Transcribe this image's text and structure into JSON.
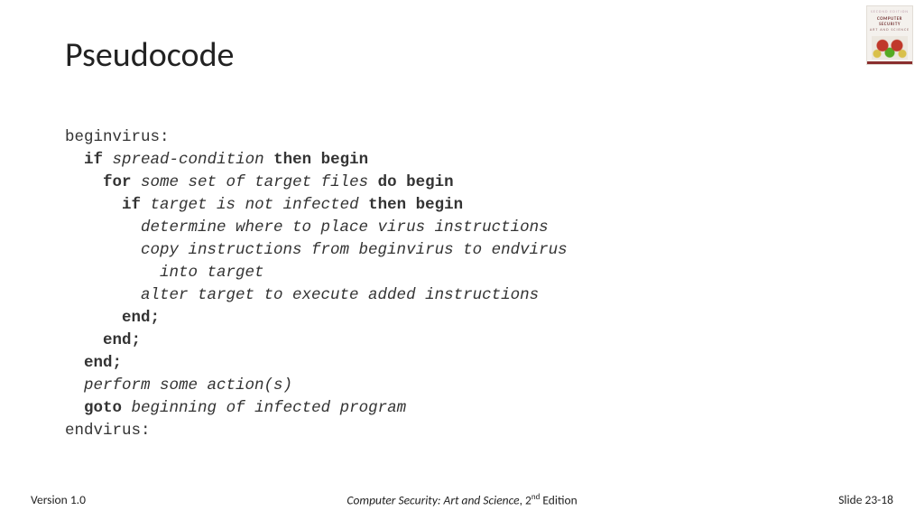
{
  "title": "Pseudocode",
  "code": {
    "l1": "beginvirus:",
    "kw_if1": "if",
    "it_spread": "spread-condition",
    "kw_thenbegin1": "then begin",
    "kw_for": "for",
    "it_someset": "some set of target files",
    "kw_dobegin": "do begin",
    "kw_if2": "if",
    "it_targetnot": "target is not infected",
    "kw_thenbegin2": "then begin",
    "it_determine": "determine where to place virus instructions",
    "it_copy": "copy instructions from beginvirus to endvirus",
    "it_into": "into target",
    "it_alter": "alter target to execute added instructions",
    "kw_end1": "end;",
    "kw_end2": "end;",
    "kw_end3": "end;",
    "it_perform": "perform some action(s)",
    "kw_goto": "goto",
    "it_beginning": "beginning of infected program",
    "l_end": "endvirus:"
  },
  "footer": {
    "left": "Version 1.0",
    "center_title": "Computer Security: Art and Science",
    "center_sep": ", 2",
    "center_sup": "nd",
    "center_tail": " Edition",
    "right": "Slide 23-18"
  },
  "cover": {
    "ed": "SECOND EDITION",
    "t1": "COMPUTER",
    "t2": "SECURITY",
    "sub": "ART AND SCIENCE"
  }
}
